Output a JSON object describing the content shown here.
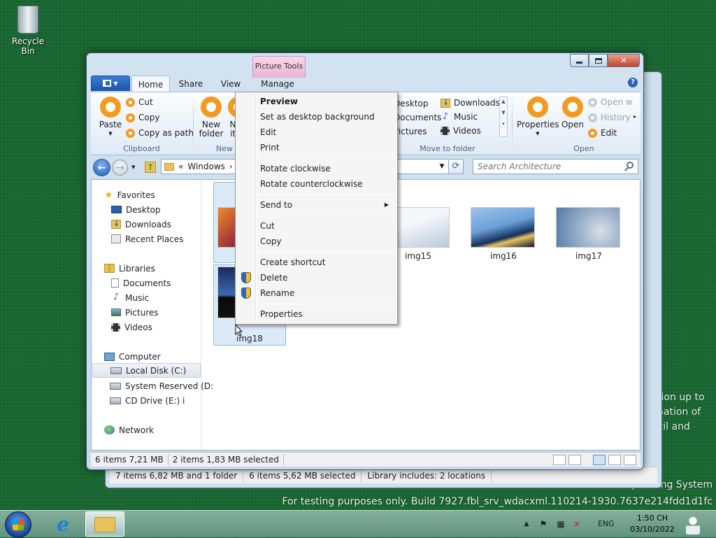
{
  "desktop": {
    "recycle_bin_label": "Recycle Bin",
    "watermark_line1": "Microsoft Pre-release Windows Operating System",
    "watermark_line2": "For testing purposes only. Build 7927.fbl_srv_wdacxml.110214-1930.7637e214fdd1d1fc",
    "partial_text": [
      "tion up to",
      "nation of",
      "vil and"
    ]
  },
  "background_window": {
    "status_segments": [
      "7 items 6,82 MB and 1 folder",
      "6 items 5,62 MB selected",
      "Library includes:  2 locations"
    ]
  },
  "window": {
    "contextual_tab_title": "Picture Tools",
    "tabs": [
      {
        "label": "Home",
        "active": true
      },
      {
        "label": "Share",
        "active": false
      },
      {
        "label": "View",
        "active": false
      },
      {
        "label": "Manage",
        "active": false
      }
    ],
    "help_label": "?",
    "caption": {
      "close_glyph": "✕"
    }
  },
  "ribbon": {
    "clipboard": {
      "paste": "Paste",
      "cut": "Cut",
      "copy": "Copy",
      "copy_as_path": "Copy as path",
      "group_label": "Clipboard"
    },
    "new": {
      "new_folder_line1": "New",
      "new_folder_line2": "folder",
      "new_item_line1": "N",
      "new_item_line2": "it",
      "group_label": "New"
    },
    "move_to": {
      "items_left": [
        "Desktop",
        "Documents",
        "Pictures"
      ],
      "items_right": [
        "Downloads",
        "Music",
        "Videos"
      ],
      "group_label": "Move to folder"
    },
    "open": {
      "properties": "Properties",
      "open": "Open",
      "open_with": "Open w",
      "history": "History",
      "edit": "Edit",
      "group_label": "Open"
    }
  },
  "address": {
    "prefix": "«",
    "crumb": "Windows",
    "crumb_sep": "›",
    "search_placeholder": "Search Architecture"
  },
  "nav": {
    "favorites": {
      "label": "Favorites",
      "items": [
        "Desktop",
        "Downloads",
        "Recent Places"
      ]
    },
    "libraries": {
      "label": "Libraries",
      "items": [
        "Documents",
        "Music",
        "Pictures",
        "Videos"
      ]
    },
    "computer": {
      "label": "Computer",
      "items": [
        "Local Disk (C:)",
        "System Reserved (D:",
        "CD Drive (E:) i"
      ]
    },
    "network": {
      "label": "Network"
    }
  },
  "files": [
    {
      "label": "img15",
      "colors": [
        "#f4f7fb",
        "#b9c9dc"
      ]
    },
    {
      "label": "img16",
      "colors": [
        "#6aa1d8",
        "#14305c"
      ]
    },
    {
      "label": "img17",
      "colors": [
        "#7ea7cf",
        "#d9dfe7"
      ]
    },
    {
      "label": "img18",
      "colors": [
        "#1a2a5a",
        "#101010"
      ]
    }
  ],
  "status": {
    "items": "6 items 7,21 MB",
    "selected": "2 items 1,83 MB selected"
  },
  "context_menu": {
    "preview": "Preview",
    "set_bg": "Set as desktop background",
    "edit": "Edit",
    "print": "Print",
    "rotate_cw": "Rotate clockwise",
    "rotate_ccw": "Rotate counterclockwise",
    "send_to": "Send to",
    "cut": "Cut",
    "copy": "Copy",
    "create_shortcut": "Create shortcut",
    "delete": "Delete",
    "rename": "Rename",
    "properties": "Properties"
  },
  "taskbar": {
    "language": "ENG",
    "time": "1:50 CH",
    "date": "03/10/2022"
  },
  "colors": {
    "accent_orange": "#f39a1f",
    "selection_blue": "#dbeaf9",
    "desktop_green": "#1c6b34"
  }
}
